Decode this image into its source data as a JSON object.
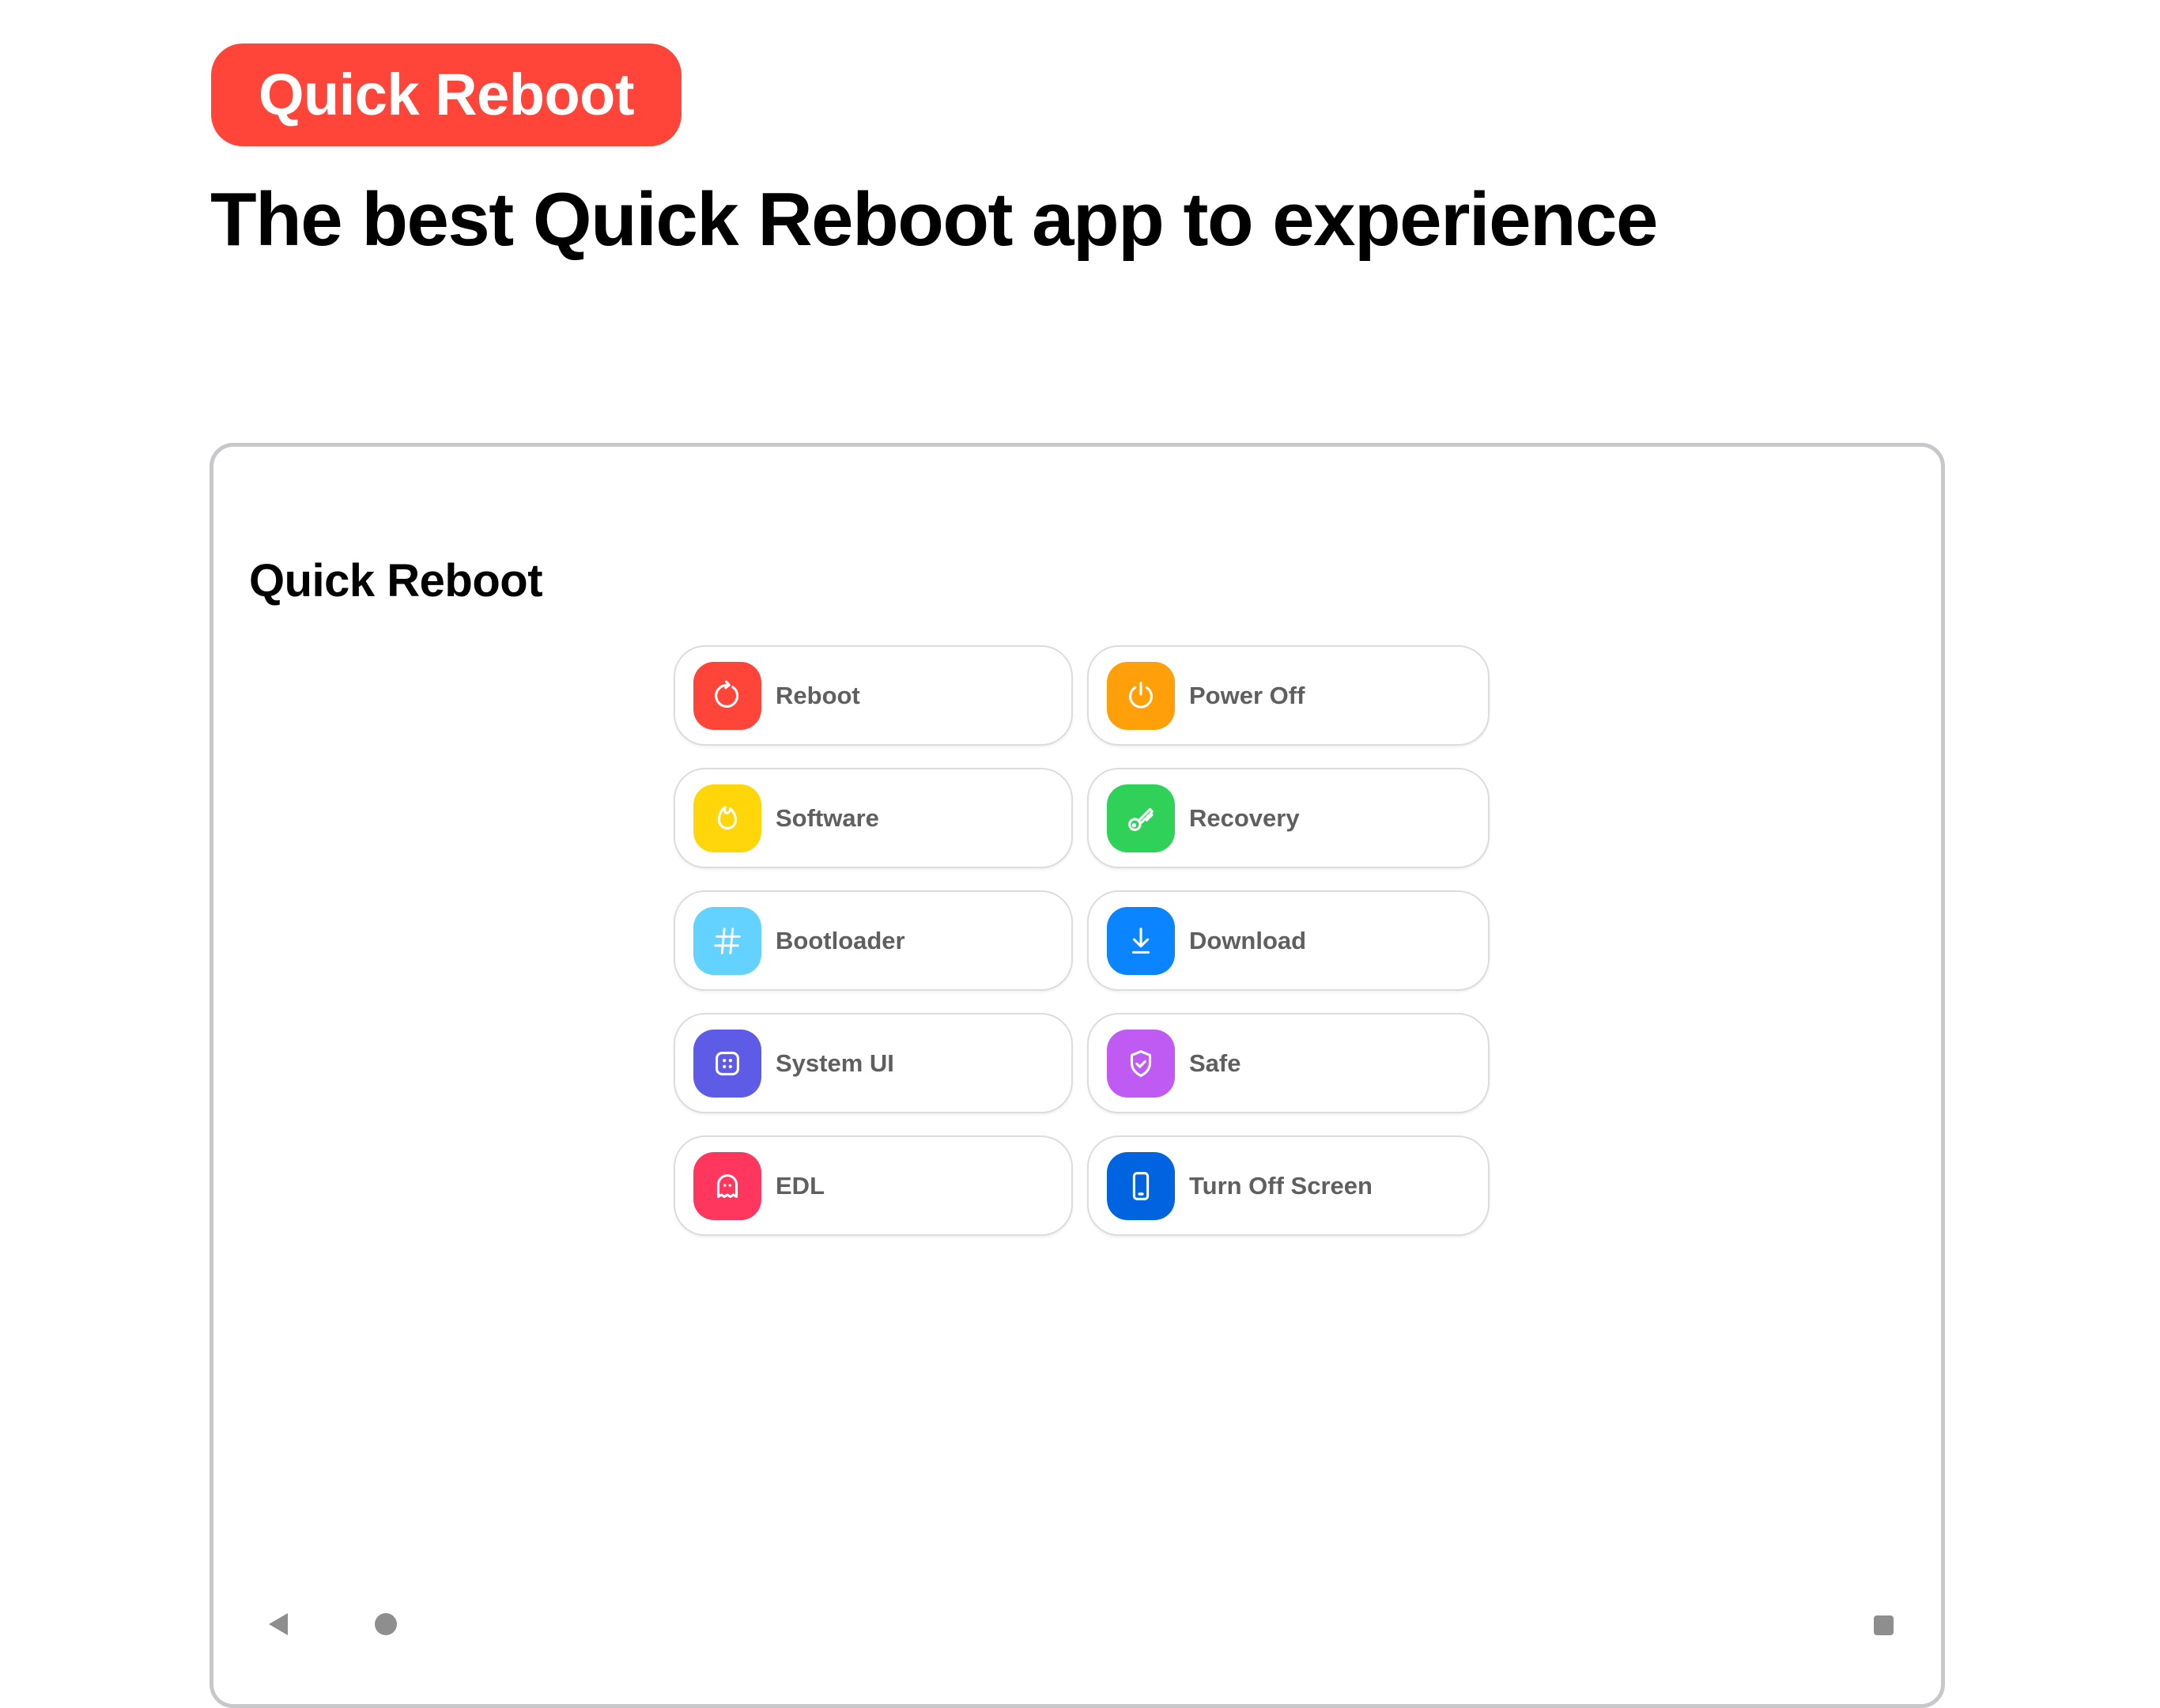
{
  "header": {
    "badge_label": "Quick Reboot",
    "headline": "The best Quick Reboot app to experience"
  },
  "app": {
    "title": "Quick Reboot",
    "actions": [
      {
        "label": "Reboot",
        "icon": "restart-icon",
        "color": "#FF453A"
      },
      {
        "label": "Power Off",
        "icon": "power-icon",
        "color": "#FF9F0A"
      },
      {
        "label": "Software",
        "icon": "flame-icon",
        "color": "#FFD60A"
      },
      {
        "label": "Recovery",
        "icon": "key-icon",
        "color": "#30D158"
      },
      {
        "label": "Bootloader",
        "icon": "hash-icon",
        "color": "#64D2FF"
      },
      {
        "label": "Download",
        "icon": "download-icon",
        "color": "#0A84FF"
      },
      {
        "label": "System UI",
        "icon": "dice-icon",
        "color": "#5E5CE6"
      },
      {
        "label": "Safe",
        "icon": "shield-check-icon",
        "color": "#BF5AF2"
      },
      {
        "label": "EDL",
        "icon": "ghost-icon",
        "color": "#FF375F"
      },
      {
        "label": "Turn Off Screen",
        "icon": "phone-icon",
        "color": "#0064E0"
      }
    ]
  },
  "navbar": {
    "buttons": [
      "back-icon",
      "home-icon",
      "recents-icon"
    ]
  }
}
